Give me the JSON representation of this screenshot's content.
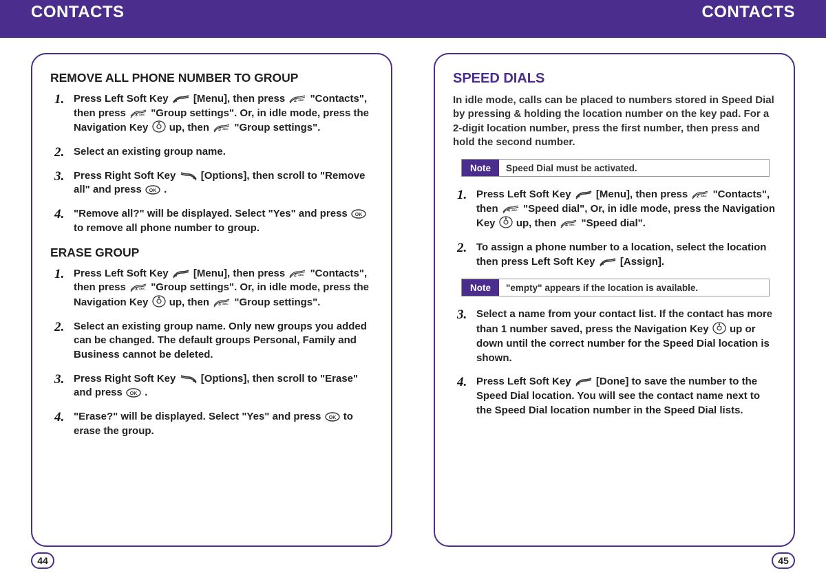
{
  "header": {
    "left": "CONTACTS",
    "right": "CONTACTS"
  },
  "left_page": {
    "section1": {
      "title": "REMOVE ALL PHONE NUMBER TO GROUP",
      "steps": [
        {
          "n": "1.",
          "parts": [
            "Press Left Soft Key ",
            "@softL",
            " [Menu], then press ",
            "@key2",
            " \"Contacts\", then press ",
            "@key3",
            " \"Group settings\". Or, in idle mode, press the Navigation Key ",
            "@dpad",
            "  up, then ",
            "@key3",
            " \"Group settings\"."
          ]
        },
        {
          "n": "2.",
          "parts": [
            "Select an existing group name."
          ]
        },
        {
          "n": "3.",
          "parts": [
            "Press Right Soft Key ",
            "@softR",
            " [Options], then scroll to \"Remove all\" and press ",
            "@ok",
            " ."
          ]
        },
        {
          "n": "4.",
          "parts": [
            "\"Remove all?\" will be displayed. Select \"Yes\" and press ",
            "@ok",
            " to remove all phone number to group."
          ]
        }
      ]
    },
    "section2": {
      "title": "ERASE GROUP",
      "steps": [
        {
          "n": "1.",
          "parts": [
            "Press Left Soft Key ",
            "@softL",
            " [Menu], then press ",
            "@key2",
            " \"Contacts\", then press ",
            "@key3",
            " \"Group settings\". Or, in idle mode, press the Navigation Key ",
            "@dpad",
            "  up, then ",
            "@key3",
            " \"Group settings\"."
          ]
        },
        {
          "n": "2.",
          "parts": [
            "Select an existing group name. Only new groups you added can be changed. The default groups Personal, Family and Business cannot be deleted."
          ]
        },
        {
          "n": "3.",
          "parts": [
            "Press Right Soft Key ",
            "@softR",
            " [Options], then scroll to \"Erase\" and press ",
            "@ok",
            " ."
          ]
        },
        {
          "n": "4.",
          "parts": [
            "\"Erase?\" will be displayed. Select \"Yes\" and press ",
            "@ok",
            " to erase the group."
          ]
        }
      ]
    }
  },
  "right_page": {
    "title": "SPEED DIALS",
    "intro": "In idle mode, calls can be placed to numbers stored in Speed Dial by pressing & holding the location number on the key pad. For a 2-digit location number, press the first number, then press and hold the second number.",
    "note1_label": "Note",
    "note1_text": "Speed Dial must be activated.",
    "steps_a": [
      {
        "n": "1.",
        "parts": [
          "Press Left Soft Key ",
          "@softL",
          " [Menu], then press ",
          "@key2",
          " \"Contacts\", then ",
          "@key4",
          " \"Speed dial\", Or, in idle mode, press the Navigation Key ",
          "@dpad",
          " up, then ",
          "@key4",
          " \"Speed dial\"."
        ]
      },
      {
        "n": "2.",
        "parts": [
          "To assign a phone number to a location, select the location then press Left Soft Key ",
          "@softL",
          " [Assign]."
        ]
      }
    ],
    "note2_label": "Note",
    "note2_text": "\"empty\" appears if the location is available.",
    "steps_b": [
      {
        "n": "3.",
        "parts": [
          "Select a name from your contact list. If the contact has more than 1 number saved, press the Navigation Key ",
          "@dpad",
          " up or down until the correct number for the Speed Dial location is shown."
        ]
      },
      {
        "n": "4.",
        "parts": [
          "Press Left Soft Key ",
          "@softL",
          " [Done] to save the number to the Speed Dial location. You will see the contact name next to the Speed Dial location number in the Speed Dial lists."
        ]
      }
    ]
  },
  "pages": {
    "left": "44",
    "right": "45"
  },
  "icons": {
    "softL": "left-softkey-icon",
    "softR": "right-softkey-icon",
    "ok": "ok-button-icon",
    "dpad": "dpad-icon",
    "key2": "keypad-2-icon",
    "key3": "keypad-3-icon",
    "key4": "keypad-4-icon"
  }
}
